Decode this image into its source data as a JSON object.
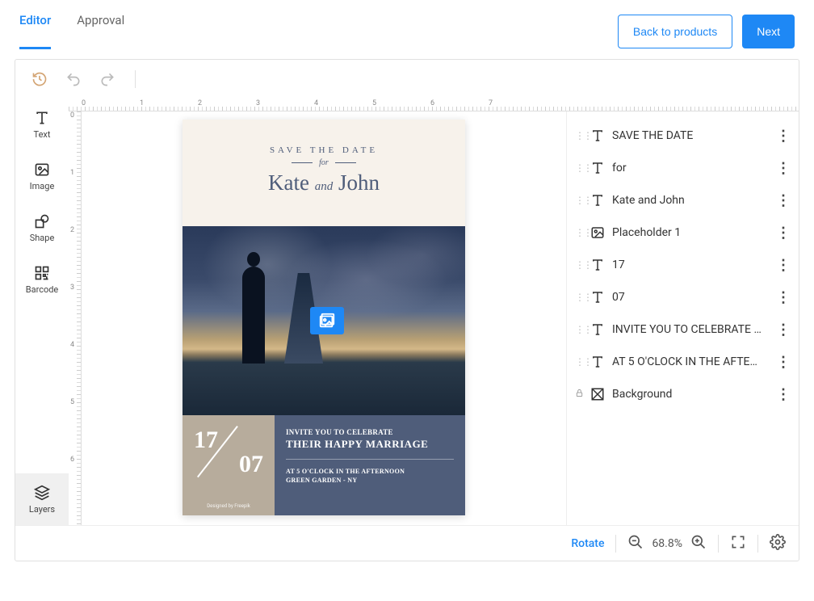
{
  "tabs": {
    "editor": "Editor",
    "approval": "Approval"
  },
  "actions": {
    "back": "Back to products",
    "next": "Next"
  },
  "tools": {
    "text": "Text",
    "image": "Image",
    "shape": "Shape",
    "barcode": "Barcode",
    "layers": "Layers"
  },
  "ruler_h": [
    "0",
    "1",
    "2",
    "3",
    "4",
    "5",
    "6",
    "7"
  ],
  "ruler_v": [
    "0",
    "1",
    "2",
    "3",
    "4",
    "5",
    "6"
  ],
  "invitation": {
    "std": "SAVE THE DATE",
    "for": "for",
    "name1": "Kate",
    "and": "and",
    "name2": "John",
    "day": "17",
    "month": "07",
    "credit": "Designed by Freepik",
    "invite_line1": "INVITE YOU TO CELEBRATE",
    "invite_line2": "THEIR HAPPY MARRIAGE",
    "invite_line3": "AT 5 O'CLOCK IN THE AFTERNOON",
    "invite_line4": "GREEN GARDEN - NY"
  },
  "layers": [
    {
      "type": "text",
      "label": "SAVE THE DATE"
    },
    {
      "type": "text",
      "label": "for"
    },
    {
      "type": "text",
      "label": "Kate and John"
    },
    {
      "type": "image",
      "label": "Placeholder 1"
    },
    {
      "type": "text",
      "label": "17"
    },
    {
      "type": "text",
      "label": "07"
    },
    {
      "type": "text",
      "label": "INVITE YOU TO CELEBRATE …"
    },
    {
      "type": "text",
      "label": "AT 5 O'CLOCK IN THE AFTE…"
    },
    {
      "type": "background",
      "label": "Background",
      "locked": true
    }
  ],
  "status": {
    "rotate": "Rotate",
    "zoom": "68.8%"
  }
}
